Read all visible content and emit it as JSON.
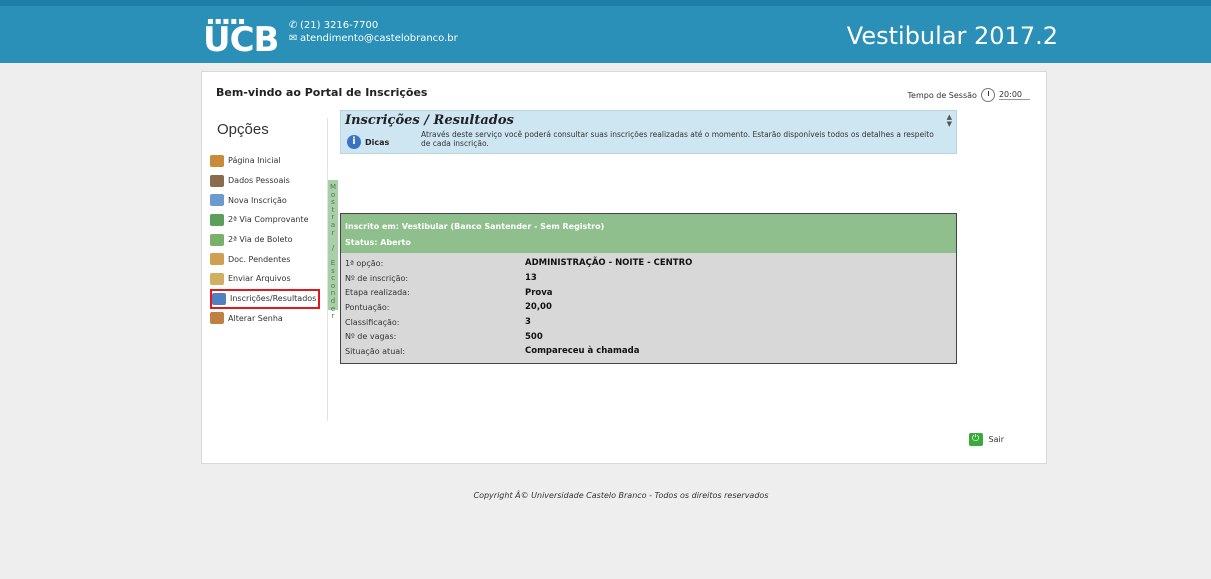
{
  "header": {
    "logo_text": "UCB",
    "phone": "(21) 3216-7700",
    "email": "atendimento@castelobranco.br",
    "exam_title": "Vestibular 2017.2",
    "bar_color": "#2a90b8"
  },
  "panel": {
    "welcome": "Bem-vindo ao Portal de Inscrições",
    "session_label": "Tempo de Sessão",
    "session_time": "20:00"
  },
  "sidebar": {
    "title": "Opções",
    "toggle_label": "Mostrar / Esconder",
    "items": [
      {
        "label": "Página Inicial",
        "icon": "home-icon",
        "color": "#c98a3a"
      },
      {
        "label": "Dados Pessoais",
        "icon": "user-icon",
        "color": "#8a6b4a"
      },
      {
        "label": "Nova Inscrição",
        "icon": "form-icon",
        "color": "#6a9ad0"
      },
      {
        "label": "2ª Via Comprovante",
        "icon": "printer-icon",
        "color": "#5aa05a"
      },
      {
        "label": "2ª Via de Boleto",
        "icon": "money-icon",
        "color": "#7ab06a"
      },
      {
        "label": "Doc. Pendentes",
        "icon": "document-icon",
        "color": "#d0a050"
      },
      {
        "label": "Enviar Arquivos",
        "icon": "upload-icon",
        "color": "#d0b060"
      },
      {
        "label": "Inscrições/Resultados",
        "icon": "results-icon",
        "color": "#5080c0",
        "active": true
      },
      {
        "label": "Alterar Senha",
        "icon": "password-icon",
        "color": "#c08040"
      }
    ]
  },
  "info": {
    "title": "Inscrições / Resultados",
    "tip_label": "Dicas",
    "tip_text": "Através deste serviço você poderá consultar suas inscrições realizadas até o momento. Estarão disponíveis todos os detalhes a respeito de cada inscrição."
  },
  "result": {
    "enrolled_in": "Inscrito em: Vestibular (Banco Santender - Sem Registro)",
    "status": "Status: Aberto",
    "rows": [
      {
        "label": "1ª opção:",
        "value": "ADMINISTRAÇÃO - NOITE - CENTRO"
      },
      {
        "label": "Nº de inscrição:",
        "value": "13"
      },
      {
        "label": "Etapa realizada:",
        "value": "Prova"
      },
      {
        "label": "Pontuação:",
        "value": "20,00"
      },
      {
        "label": "Classificação:",
        "value": "3"
      },
      {
        "label": "Nº de vagas:",
        "value": "500"
      },
      {
        "label": "Situação atual:",
        "value": "Compareceu à chamada"
      }
    ]
  },
  "exit_label": "Sair",
  "copyright": "Copyright Â© Universidade Castelo Branco - Todos os direitos reservados"
}
